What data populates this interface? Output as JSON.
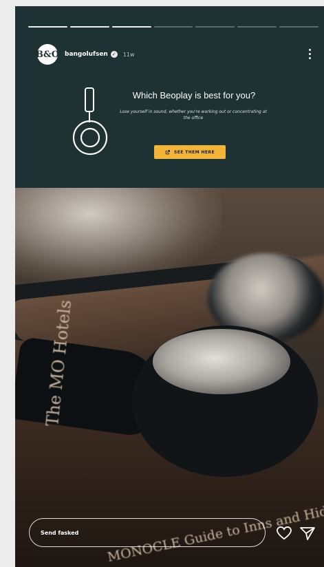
{
  "story": {
    "progress_total": 7,
    "progress_done": 3,
    "username": "bangolufsen",
    "time": "11w",
    "avatar_text": "B&O"
  },
  "ad": {
    "title": "Which Beoplay is best for you?",
    "subtitle": "Lose yourself in sound, whether you're working out or concentrating at the office",
    "cta_label": "SEE THEM HERE",
    "cta_color": "#f2b53a",
    "bg_color": "#1e3233"
  },
  "photo": {
    "book_title_spine": "The MO Hotels",
    "book_title_cover": "MONOCLE Guide to Inns and Hideaways"
  },
  "reply": {
    "placeholder": "Send fasked"
  },
  "icons": {
    "more": "more-vertical-icon",
    "heart": "heart-icon",
    "send": "send-icon",
    "verified": "verified-badge-icon",
    "link": "link-icon"
  }
}
